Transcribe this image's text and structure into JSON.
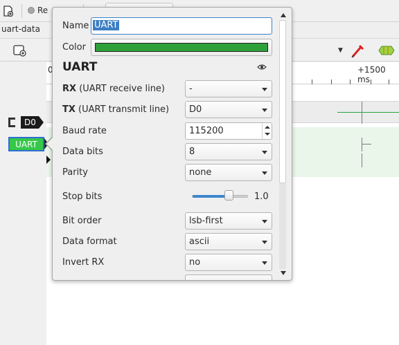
{
  "app": {
    "tab_label": "Re",
    "session_title": "uart-data",
    "ruler_zero": "0",
    "ruler_right_label": "+1500 ms",
    "signals": {
      "d0_label": "D0",
      "uart_label": "UART"
    }
  },
  "popup": {
    "name_label": "Name",
    "name_value": "UART",
    "color_label": "Color",
    "color_value": "#2ea03a",
    "decoder_title": "UART",
    "fields": {
      "rx": {
        "bold": "RX",
        "desc": "(UART receive line)",
        "value": "-"
      },
      "tx": {
        "bold": "TX",
        "desc": "(UART transmit line)",
        "value": "D0"
      },
      "baud_rate": {
        "label": "Baud rate",
        "value": "115200"
      },
      "data_bits": {
        "label": "Data bits",
        "value": "8"
      },
      "parity": {
        "label": "Parity",
        "value": "none"
      },
      "stop_bits": {
        "label": "Stop bits",
        "value": "1.0",
        "slider_fraction": 0.65
      },
      "bit_order": {
        "label": "Bit order",
        "value": "lsb-first"
      },
      "data_format": {
        "label": "Data format",
        "value": "ascii"
      },
      "invert_rx": {
        "label": "Invert RX",
        "value": "no"
      }
    }
  },
  "colors": {
    "accent_blue": "#3d7fc4",
    "signal_green": "#37c84a"
  }
}
